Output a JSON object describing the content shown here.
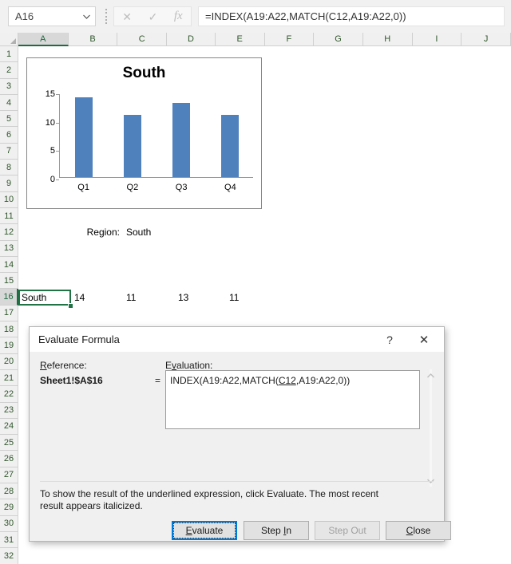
{
  "formula_bar": {
    "name_box_value": "A16",
    "name_box_dropdown_icon": "chevron-down-icon",
    "cancel_icon": "✕",
    "enter_icon": "✓",
    "function_icon": "fx",
    "formula_value": "=INDEX(A19:A22,MATCH(C12,A19:A22,0))"
  },
  "grid": {
    "columns": [
      "A",
      "B",
      "C",
      "D",
      "E",
      "F",
      "G",
      "H",
      "I",
      "J"
    ],
    "active_column": "A",
    "rows": [
      1,
      2,
      3,
      4,
      5,
      6,
      7,
      8,
      9,
      10,
      11,
      12,
      13,
      14,
      15,
      16,
      17,
      18,
      19,
      20,
      21,
      22,
      23,
      24,
      25,
      26,
      27,
      28,
      29,
      30,
      31,
      32
    ],
    "active_row": 16,
    "cells": [
      {
        "ref": "B12",
        "text": "Region:",
        "align": "right"
      },
      {
        "ref": "C12",
        "text": "South",
        "align": "left"
      },
      {
        "ref": "A16",
        "text": "South",
        "align": "left"
      },
      {
        "ref": "B16",
        "text": "14",
        "align": "left"
      },
      {
        "ref": "C16",
        "text": "11",
        "align": "left"
      },
      {
        "ref": "D16",
        "text": "13",
        "align": "left"
      },
      {
        "ref": "E16",
        "text": "11",
        "align": "left"
      }
    ],
    "selected_cell": "A16"
  },
  "chart_data": {
    "type": "bar",
    "title": "South",
    "categories": [
      "Q1",
      "Q2",
      "Q3",
      "Q4"
    ],
    "values": [
      14,
      11,
      13,
      11
    ],
    "xlabel": "",
    "ylabel": "",
    "ylim": [
      0,
      15
    ],
    "yticks": [
      0,
      5,
      10,
      15
    ],
    "grid": false,
    "legend": "none",
    "series_color": "#4F81BD"
  },
  "dialog": {
    "title": "Evaluate Formula",
    "help_label": "?",
    "close_label": "✕",
    "reference_label": "Reference:",
    "reference_label_accel": "R",
    "evaluation_label": "Evaluation:",
    "evaluation_label_accel": "v",
    "reference_value": "Sheet1!$A$16",
    "equals": "=",
    "evaluation_before": "INDEX(A19:A22,MATCH(",
    "evaluation_underlined": "C12",
    "evaluation_after": ",A19:A22,0))",
    "scroll_up_icon": "chevron-up-icon",
    "scroll_down_icon": "chevron-down-icon",
    "hint_line1": "To show the result of the underlined expression, click Evaluate.  The most recent",
    "hint_line2": "result appears italicized.",
    "buttons": {
      "evaluate": {
        "label": "Evaluate",
        "accel": "E",
        "state": "default-focused"
      },
      "step_in": {
        "label": "Step In",
        "accel": "I",
        "state": "enabled"
      },
      "step_out": {
        "label": "Step Out",
        "accel": "",
        "state": "disabled"
      },
      "close": {
        "label": "Close",
        "accel": "C",
        "state": "enabled"
      }
    }
  }
}
